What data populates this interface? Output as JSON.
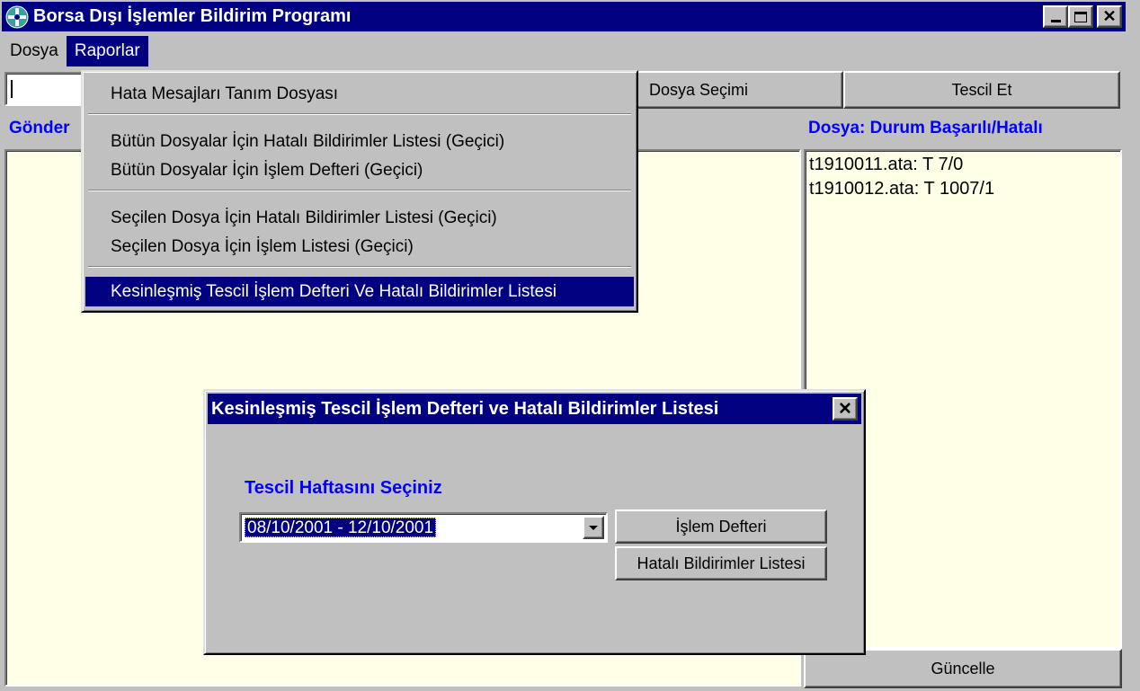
{
  "window": {
    "title": "Borsa Dışı İşlemler Bildirim Programı",
    "controls": {
      "minimize": "_",
      "maximize": "□",
      "close": "✕"
    }
  },
  "menubar": {
    "items": [
      "Dosya",
      "Raporlar"
    ],
    "active": "Raporlar"
  },
  "toolbar": {
    "input_value": "",
    "file_select_label": "Dosya Seçimi",
    "register_label": "Tescil Et"
  },
  "left_panel": {
    "label": "Gönder"
  },
  "right_panel": {
    "label": "Dosya: Durum Başarılı/Hatalı",
    "files": [
      "t1910011.ata: T 7/0",
      "t1910012.ata: T 1007/1"
    ],
    "refresh_label": "Güncelle"
  },
  "reports_menu": {
    "items": [
      "Hata Mesajları Tanım Dosyası",
      "Bütün Dosyalar İçin Hatalı Bildirimler Listesi (Geçici)",
      "Bütün Dosyalar İçin İşlem Defteri (Geçici)",
      "Seçilen Dosya İçin Hatalı Bildirimler Listesi (Geçici)",
      "Seçilen Dosya İçin İşlem Listesi (Geçici)",
      "Kesinleşmiş Tescil İşlem Defteri Ve Hatalı Bildirimler Listesi"
    ],
    "selected_index": 5
  },
  "dialog": {
    "title": "Kesinleşmiş Tescil İşlem Defteri ve Hatalı Bildirimler Listesi",
    "close": "✕",
    "prompt": "Tescil Haftasını Seçiniz",
    "week_value": "08/10/2001 - 12/10/2001",
    "ledger_button": "İşlem Defteri",
    "errors_button": "Hatalı Bildirimler Listesi"
  },
  "colors": {
    "titlebar": "#000080",
    "label_blue": "#0000ff",
    "panel_bg": "#ffffe8",
    "face": "#c0c0c0"
  }
}
